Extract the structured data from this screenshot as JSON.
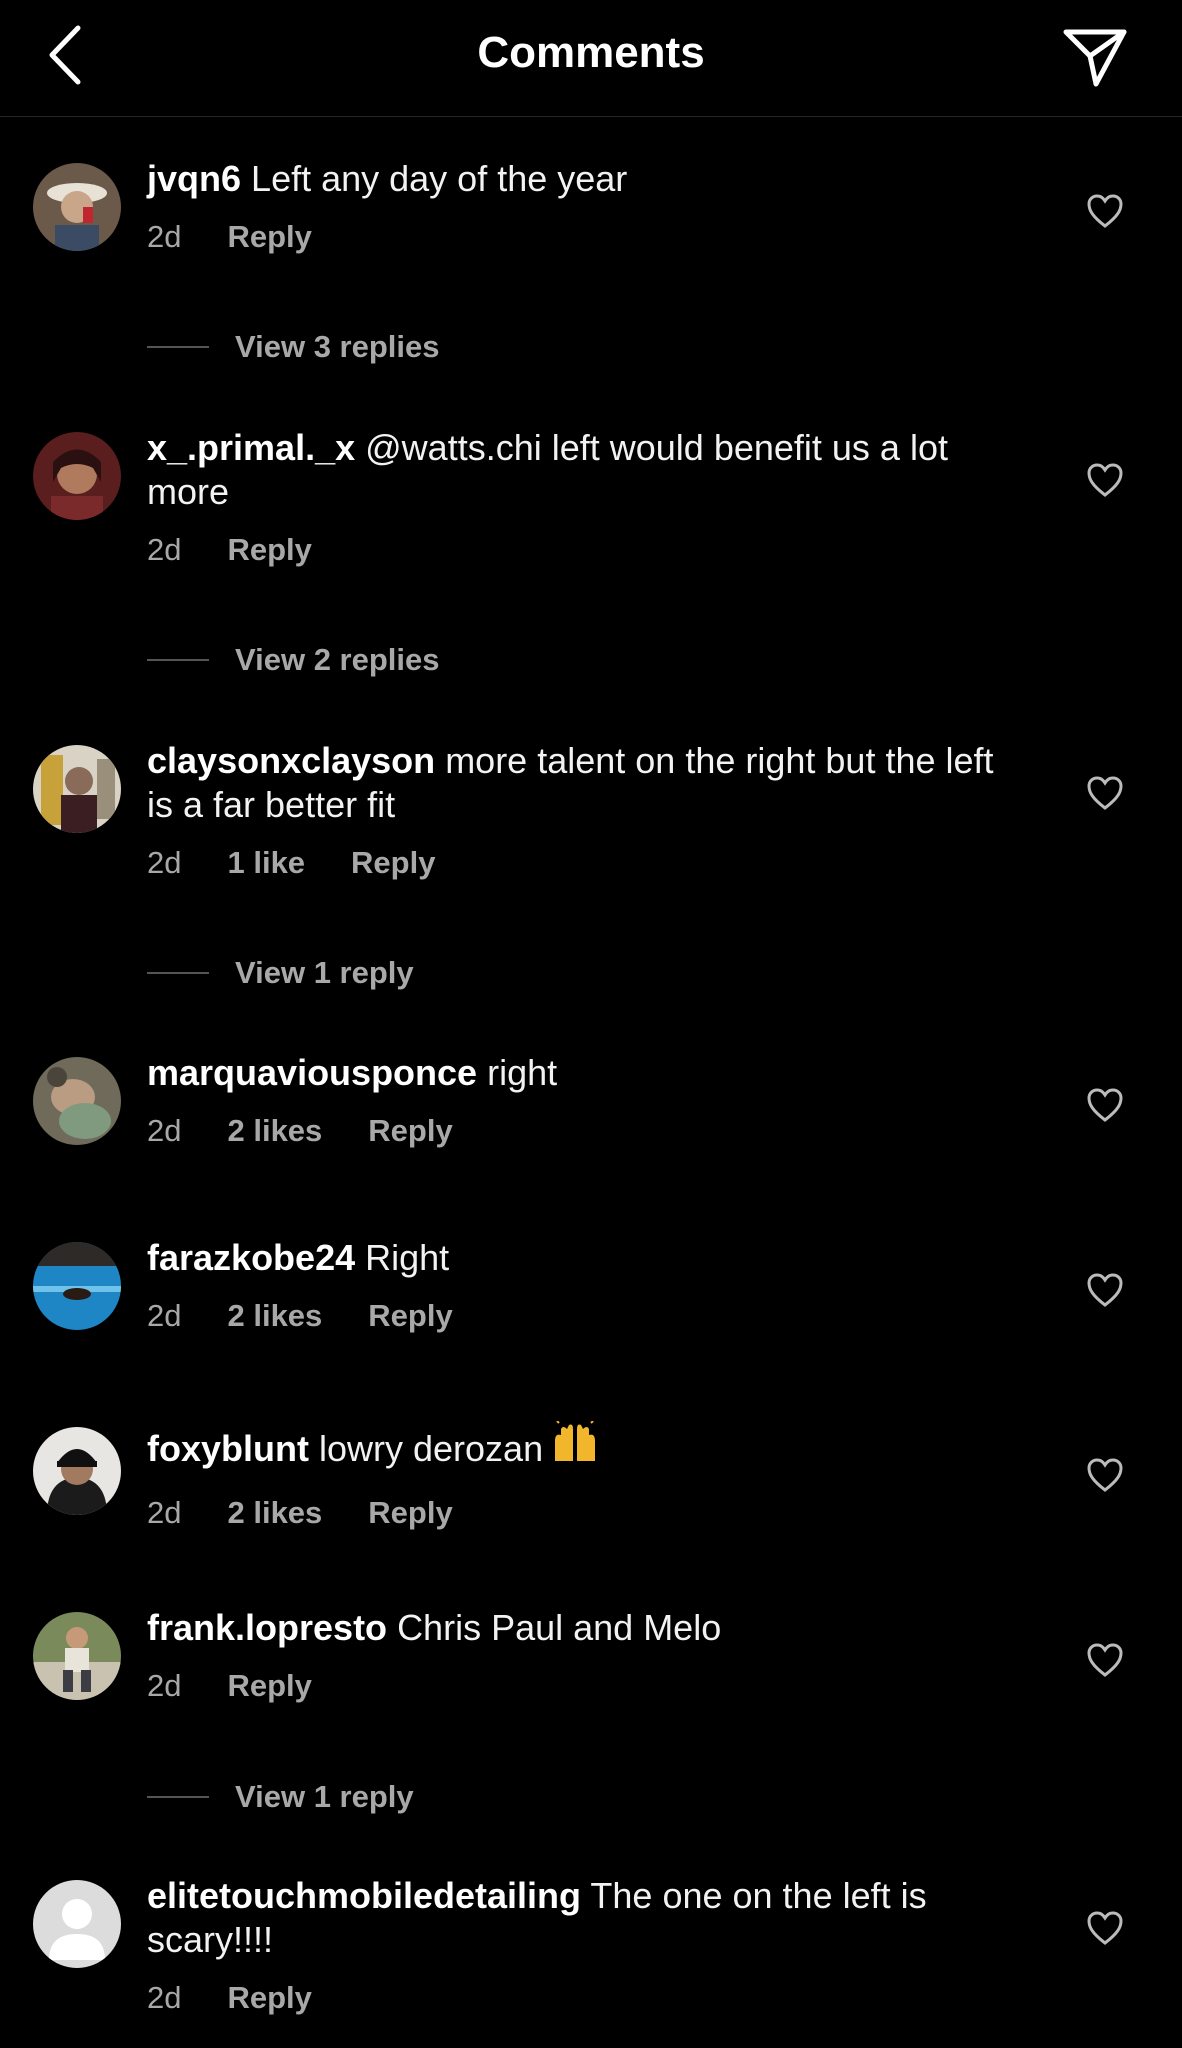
{
  "header": {
    "title": "Comments",
    "back_icon": "chevron-left-icon",
    "send_icon": "paper-plane-icon"
  },
  "colors": {
    "background": "#000000",
    "text": "#f5f5f5",
    "muted": "#a8a8a8"
  },
  "comments": [
    {
      "username": "jvqn6",
      "text": "Left any day of the year",
      "time": "2d",
      "likes": "",
      "reply": "Reply",
      "view_replies": "View 3 replies"
    },
    {
      "username": "x_.primal._x",
      "text": "@watts.chi left would benefit us a lot more",
      "time": "2d",
      "likes": "",
      "reply": "Reply",
      "view_replies": "View 2 replies"
    },
    {
      "username": "claysonxclayson",
      "text": "more talent on the right but the left is a far better fit",
      "time": "2d",
      "likes": "1 like",
      "reply": "Reply",
      "view_replies": "View 1 reply"
    },
    {
      "username": "marquaviousponce",
      "text": "right",
      "time": "2d",
      "likes": "2 likes",
      "reply": "Reply",
      "view_replies": ""
    },
    {
      "username": "farazkobe24",
      "text": "Right",
      "time": "2d",
      "likes": "2 likes",
      "reply": "Reply",
      "view_replies": ""
    },
    {
      "username": "foxyblunt",
      "text": "lowry derozan",
      "emoji": "raising-hands-emoji",
      "time": "2d",
      "likes": "2 likes",
      "reply": "Reply",
      "view_replies": ""
    },
    {
      "username": "frank.lopresto",
      "text": "Chris Paul and Melo",
      "time": "2d",
      "likes": "",
      "reply": "Reply",
      "view_replies": "View 1 reply"
    },
    {
      "username": "elitetouchmobiledetailing",
      "text": "The one on the left is scary!!!!",
      "time": "2d",
      "likes": "",
      "reply": "Reply",
      "view_replies": ""
    }
  ]
}
